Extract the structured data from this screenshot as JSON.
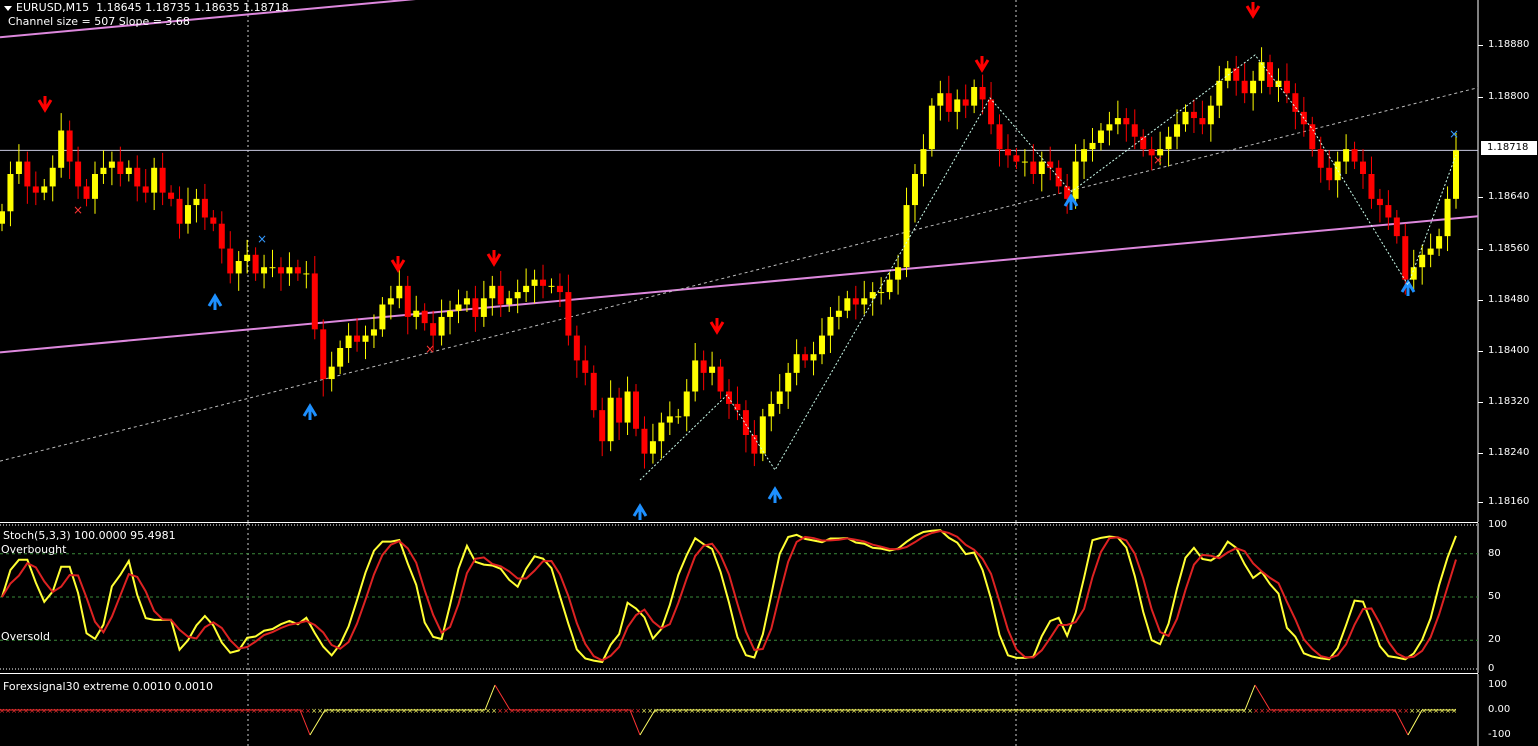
{
  "chart_header": {
    "symbol_line": "EURUSD,M15  1.18645 1.18735 1.18635 1.18718",
    "channel_line": "Channel size = 507 Slope = 3.68"
  },
  "main_axis": {
    "ticks": [
      "1.18880",
      "1.18800",
      "1.18718",
      "1.18640",
      "1.18560",
      "1.18480",
      "1.18400",
      "1.18320",
      "1.18240",
      "1.18160"
    ],
    "current_price": "1.18718"
  },
  "stoch": {
    "title": "Stoch(5,3,3) 100.0000 95.4981",
    "overbought_label": "Overbought",
    "oversold_label": "Oversold",
    "ticks": [
      "100",
      "80",
      "50",
      "20",
      "0"
    ]
  },
  "forexsignal": {
    "title": "Forexsignal30 extreme 0.0010 0.0010",
    "ticks": [
      "100",
      "0.00",
      "-100"
    ]
  },
  "colors": {
    "bull": "#ffff00",
    "bear": "#ff0000",
    "channel": "#dd88dd",
    "stoch_main": "#ffff33",
    "stoch_signal": "#dd2222",
    "arrow_up": "#1e90ff",
    "arrow_down": "#ff0000"
  },
  "chart_data": {
    "type": "candlestick",
    "symbol": "EURUSD",
    "timeframe": "M15",
    "ylim": [
      1.1812,
      1.1896
    ],
    "close": [
      1.1862,
      1.1868,
      1.187,
      1.1866,
      1.1865,
      1.1866,
      1.1869,
      1.1875,
      1.187,
      1.1866,
      1.1864,
      1.1868,
      1.1869,
      1.187,
      1.1868,
      1.1869,
      1.1866,
      1.1865,
      1.1869,
      1.1865,
      1.1864,
      1.186,
      1.1863,
      1.1864,
      1.1861,
      1.186,
      1.1856,
      1.1852,
      1.1854,
      1.1855,
      1.1852,
      1.1853,
      1.1853,
      1.1852,
      1.1853,
      1.1852,
      1.1852,
      1.1843,
      1.1835,
      1.1837,
      1.184,
      1.1842,
      1.1841,
      1.1842,
      1.1843,
      1.1847,
      1.1848,
      1.185,
      1.1845,
      1.1846,
      1.1844,
      1.1842,
      1.1845,
      1.1846,
      1.1847,
      1.1848,
      1.1845,
      1.1848,
      1.185,
      1.1847,
      1.1848,
      1.1849,
      1.185,
      1.1851,
      1.185,
      1.185,
      1.1849,
      1.1842,
      1.1838,
      1.1836,
      1.183,
      1.1825,
      1.1832,
      1.1828,
      1.1833,
      1.1827,
      1.1823,
      1.1825,
      1.1828,
      1.1829,
      1.1829,
      1.1833,
      1.1838,
      1.1836,
      1.1837,
      1.1833,
      1.1831,
      1.183,
      1.1826,
      1.1823,
      1.1829,
      1.1831,
      1.1833,
      1.1836,
      1.1839,
      1.1838,
      1.1839,
      1.1842,
      1.1845,
      1.1846,
      1.1848,
      1.1847,
      1.1848,
      1.1849,
      1.1849,
      1.1851,
      1.1853,
      1.1863,
      1.1868,
      1.1872,
      1.1879,
      1.1881,
      1.1878,
      1.188,
      1.1879,
      1.1882,
      1.188,
      1.1876,
      1.1872,
      1.1871,
      1.187,
      1.187,
      1.1868,
      1.187,
      1.1869,
      1.1866,
      1.1864,
      1.187,
      1.1872,
      1.1873,
      1.1875,
      1.1876,
      1.1877,
      1.1876,
      1.1874,
      1.1872,
      1.1871,
      1.1872,
      1.1874,
      1.1876,
      1.1878,
      1.1877,
      1.1876,
      1.1879,
      1.1883,
      1.1885,
      1.1883,
      1.1881,
      1.1883,
      1.1886,
      1.1882,
      1.1883,
      1.1881,
      1.1878,
      1.1876,
      1.1872,
      1.1869,
      1.1867,
      1.187,
      1.1872,
      1.187,
      1.1868,
      1.1864,
      1.1863,
      1.1861,
      1.1858,
      1.1851,
      1.1853,
      1.1855,
      1.1856,
      1.1858,
      1.1864,
      1.18718
    ]
  }
}
